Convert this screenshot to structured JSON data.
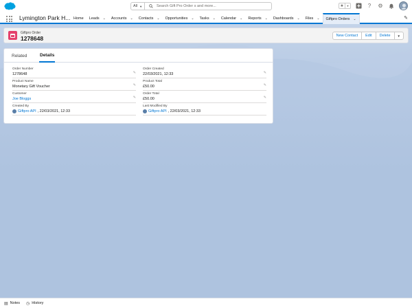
{
  "app": {
    "name": "Lymington Park H..."
  },
  "search": {
    "scope": "All",
    "placeholder": "Search Gift Pro Order s and more..."
  },
  "nav": {
    "items": [
      {
        "label": "Home",
        "chevron": false
      },
      {
        "label": "Leads",
        "chevron": true
      },
      {
        "label": "Accounts",
        "chevron": true
      },
      {
        "label": "Contacts",
        "chevron": true
      },
      {
        "label": "Opportunities",
        "chevron": true
      },
      {
        "label": "Tasks",
        "chevron": true
      },
      {
        "label": "Calendar",
        "chevron": true
      },
      {
        "label": "Reports",
        "chevron": true
      },
      {
        "label": "Dashboards",
        "chevron": true
      },
      {
        "label": "Files",
        "chevron": true
      },
      {
        "label": "Giftpro Orders",
        "chevron": true,
        "active": true
      }
    ]
  },
  "record": {
    "object_label": "Giftpro Order",
    "title": "1278648",
    "actions": [
      "New Contact",
      "Edit",
      "Delete"
    ]
  },
  "tabs": {
    "related": "Related",
    "details": "Details"
  },
  "fields": {
    "order_number": {
      "label": "Order Number",
      "value": "1278648"
    },
    "order_created": {
      "label": "Order Created",
      "value": "22/03/2021, 12:33"
    },
    "product_name": {
      "label": "Product Name",
      "value": "Monetary Gift Voucher"
    },
    "product_total": {
      "label": "Product Total",
      "value": "£50.00"
    },
    "customer": {
      "label": "Customer",
      "value": "Joe Bloggs"
    },
    "order_total": {
      "label": "Order Total",
      "value": "£50.00"
    },
    "created_by": {
      "label": "Created By",
      "user": "Giftpro API",
      "date": ", 22/03/2021, 12:33"
    },
    "last_modified_by": {
      "label": "Last Modified By",
      "user": "Giftpro API",
      "date": ", 22/03/2021, 12:33"
    }
  },
  "footer": {
    "notes": "Notes",
    "history": "History"
  },
  "colors": {
    "brand": "#0176d3",
    "record_icon": "#e4406b",
    "background": "#b0c4df"
  }
}
